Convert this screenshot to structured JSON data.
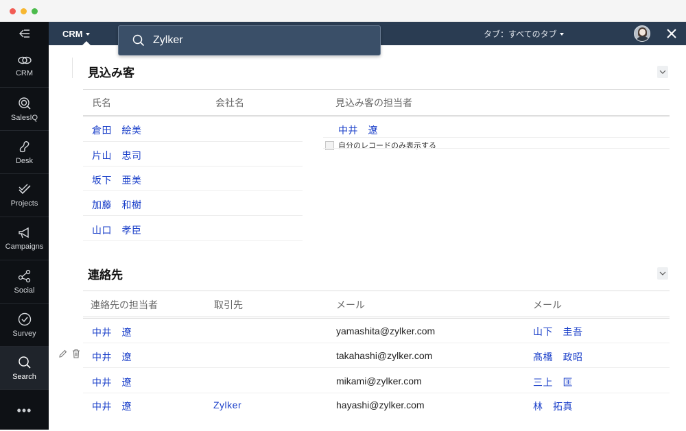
{
  "sidebar": {
    "items": [
      {
        "label": "CRM",
        "icon": "crm-icon"
      },
      {
        "label": "SalesIQ",
        "icon": "salesiq-icon"
      },
      {
        "label": "Desk",
        "icon": "desk-icon"
      },
      {
        "label": "Projects",
        "icon": "projects-icon"
      },
      {
        "label": "Campaigns",
        "icon": "megaphone-icon"
      },
      {
        "label": "Social",
        "icon": "share-icon"
      },
      {
        "label": "Survey",
        "icon": "check-circle-icon"
      },
      {
        "label": "Search",
        "icon": "search-icon"
      }
    ],
    "more": "•••"
  },
  "topbar": {
    "app_menu": "CRM",
    "tabs_menu": "タブ：すべてのタブ"
  },
  "search": {
    "value": "Zylker"
  },
  "leads": {
    "title": "見込み客",
    "columns": [
      "氏名",
      "会社名",
      "見込み客の担当者"
    ],
    "names": [
      "倉田　絵美",
      "片山　忠司",
      "坂下　亜美",
      "加藤　和樹",
      "山口　孝臣"
    ],
    "owner": "中井　遼",
    "my_records_label": "自分のレコードのみ表示する"
  },
  "contacts": {
    "title": "連絡先",
    "columns": [
      "連絡先の担当者",
      "取引先",
      "メール",
      "メール"
    ],
    "rows": [
      {
        "owner": "中井　遼",
        "account": "",
        "email": "yamashita@zylker.com",
        "name": "山下　圭吾"
      },
      {
        "owner": "中井　遼",
        "account": "",
        "email": "takahashi@zylker.com",
        "name": "髙橋　政昭"
      },
      {
        "owner": "中井　遼",
        "account": "",
        "email": "mikami@zylker.com",
        "name": "三上　匡"
      },
      {
        "owner": "中井　遼",
        "account": "Zylker",
        "email": "hayashi@zylker.com",
        "name": "林　拓真"
      }
    ]
  },
  "colors": {
    "sidebar_bg": "#0e1115",
    "topbar_bg": "#2a3c52",
    "link": "#1a3fc9"
  }
}
